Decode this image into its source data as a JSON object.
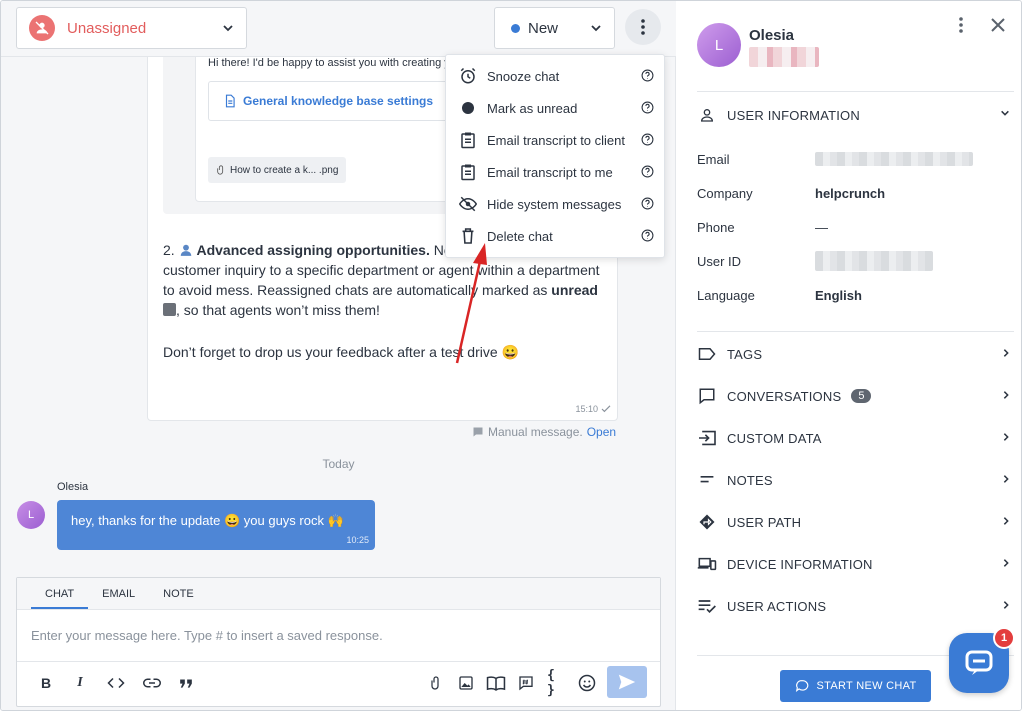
{
  "header": {
    "assignee_label": "Unassigned",
    "status_label": "New"
  },
  "message": {
    "greeting_snippet": "Hi there! I'd be happy to assist you with creating y",
    "kb_link_label": "General knowledge base settings",
    "attachment_name": "How to create a k... .png",
    "para2_prefix": "2. ",
    "para2_bold": "Advanced assigning opportunities.",
    "para2_text1": " Now you can assign a customer inquiry to a specific department or agent within a department to avoid mess. Reassigned chats are automatically marked as ",
    "para2_bold2": "unread",
    "para2_text2": ", so that agents won’t miss them!",
    "para3": "Don’t forget to drop us your feedback after a test drive 😀",
    "time": "15:10",
    "manual_label": "Manual message.",
    "manual_open": "Open"
  },
  "day_divider": "Today",
  "incoming": {
    "sender": "Olesia",
    "avatar_letter": "L",
    "text": "hey, thanks for the update 😀  you guys rock 🙌",
    "time": "10:25"
  },
  "composer": {
    "tabs": [
      "CHAT",
      "EMAIL",
      "NOTE"
    ],
    "placeholder": "Enter your message here. Type # to insert a saved response."
  },
  "menu": {
    "items": [
      {
        "label": "Snooze chat",
        "icon": "alarm-clock-icon"
      },
      {
        "label": "Mark as unread",
        "icon": "dot-icon"
      },
      {
        "label": "Email transcript to client",
        "icon": "clipboard-icon"
      },
      {
        "label": "Email transcript to me",
        "icon": "clipboard-icon"
      },
      {
        "label": "Hide system messages",
        "icon": "eye-off-icon"
      },
      {
        "label": "Delete chat",
        "icon": "trash-icon"
      }
    ]
  },
  "profile": {
    "avatar_letter": "L",
    "name": "Olesia",
    "user_info_title": "USER INFORMATION",
    "fields": [
      {
        "key": "Email",
        "value": ""
      },
      {
        "key": "Company",
        "value": "helpcrunch"
      },
      {
        "key": "Phone",
        "value": "—"
      },
      {
        "key": "User ID",
        "value": ""
      },
      {
        "key": "Language",
        "value": "English"
      }
    ],
    "sections": [
      {
        "label": "TAGS",
        "icon": "tag-icon"
      },
      {
        "label": "CONVERSATIONS",
        "icon": "chat-bubble-icon",
        "badge": "5"
      },
      {
        "label": "CUSTOM DATA",
        "icon": "import-icon"
      },
      {
        "label": "NOTES",
        "icon": "notes-icon"
      },
      {
        "label": "USER PATH",
        "icon": "directions-icon"
      },
      {
        "label": "DEVICE INFORMATION",
        "icon": "devices-icon"
      },
      {
        "label": "USER ACTIONS",
        "icon": "list-check-icon"
      }
    ],
    "start_chat_label": "START NEW CHAT"
  },
  "widget_badge": "1",
  "colors": {
    "accent": "#3a7bd5",
    "danger": "#e25d5d",
    "bubble": "#4e86d6"
  }
}
